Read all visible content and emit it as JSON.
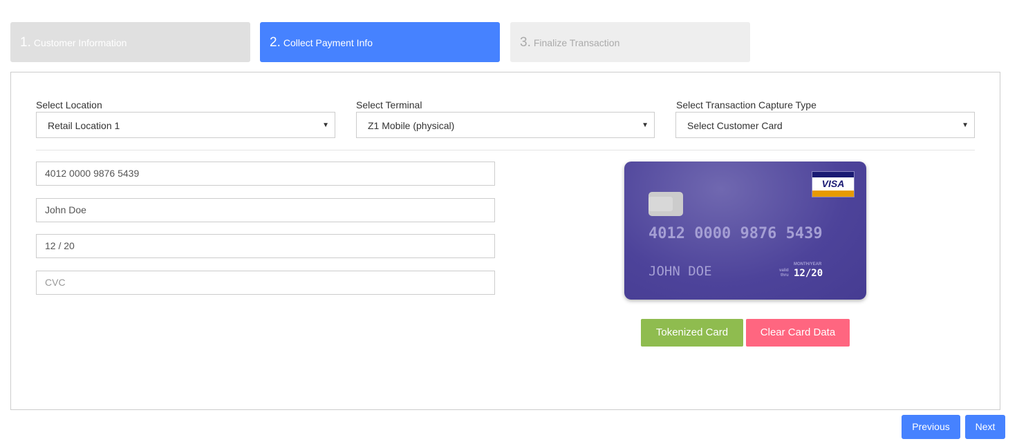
{
  "steps": [
    {
      "num": "1.",
      "label": "Customer Information"
    },
    {
      "num": "2.",
      "label": "Collect Payment Info"
    },
    {
      "num": "3.",
      "label": "Finalize Transaction"
    }
  ],
  "fields": {
    "location_label": "Select Location",
    "location_value": "Retail Location 1",
    "terminal_label": "Select Terminal",
    "terminal_value": "Z1 Mobile (physical)",
    "capture_label": "Select Transaction Capture Type",
    "capture_value": "Select Customer Card"
  },
  "card_inputs": {
    "number": "4012 0000 9876 5439",
    "name": "John Doe",
    "expiry": "12 / 20",
    "cvc_placeholder": "CVC"
  },
  "card_preview": {
    "brand": "VISA",
    "number": "4012 0000 9876 5439",
    "name": "JOHN DOE",
    "valid": "valid",
    "thru": "thru",
    "month_year": "MONTH/YEAR",
    "expiry": "12/20"
  },
  "actions": {
    "tokenized": "Tokenized Card",
    "clear": "Clear Card Data",
    "previous": "Previous",
    "next": "Next"
  },
  "colors": {
    "primary": "#4682ff",
    "success": "#8fbc4f",
    "danger": "#ff6680"
  }
}
